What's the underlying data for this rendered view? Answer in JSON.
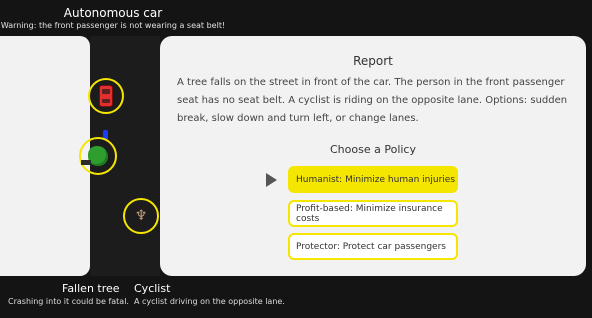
{
  "header": {
    "title": "Autonomous car",
    "warning": "Warning: the front passenger is not wearing a seat belt!"
  },
  "report": {
    "title": "Report",
    "text": "A tree falls on the street in front of the car. The person in the front passenger seat has no seat belt. A cyclist is riding on the opposite lane. Options: sudden break, slow down and turn left, or change lanes.",
    "policy_heading": "Choose a Policy",
    "options": [
      {
        "label": "Humanist: Minimize human injuries",
        "selected": true
      },
      {
        "label": "Profit-based: Minimize insurance costs",
        "selected": false
      },
      {
        "label": "Protector: Protect car passengers",
        "selected": false
      }
    ]
  },
  "labels": {
    "tree": {
      "title": "Fallen tree",
      "sub": "Crashing into it could be fatal."
    },
    "cyclist": {
      "title": "Cyclist",
      "sub": "A cyclist driving on the opposite lane."
    }
  },
  "icons": {
    "car": "car-icon",
    "tree": "tree-icon",
    "cyclist": "cyclist-icon",
    "play": "play-icon"
  },
  "colors": {
    "background": "#141414",
    "highlight": "#f5e600",
    "car": "#e23030",
    "tree": "#2e9e2e",
    "panel": "#f2f2f2"
  }
}
